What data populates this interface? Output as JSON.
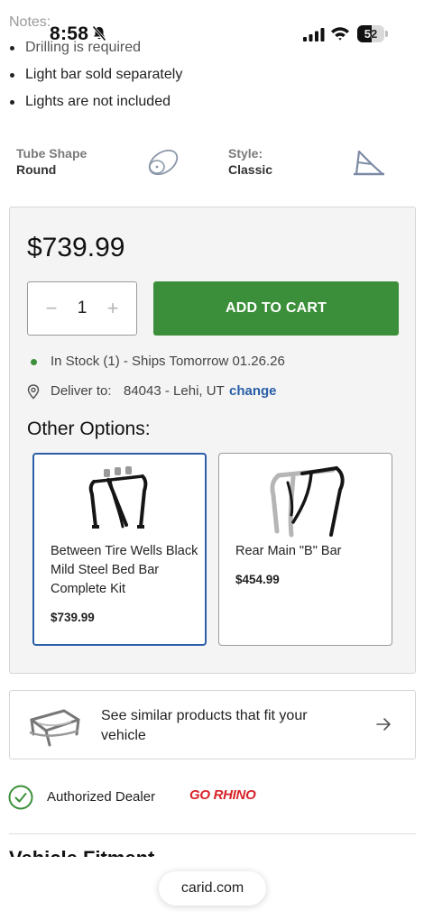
{
  "status_bar": {
    "notes_heading": "Notes:",
    "time": "8:58",
    "battery": "52",
    "battery_level": 0.52
  },
  "notes": [
    "Drilling is required",
    "Light bar sold separately",
    "Lights are not included"
  ],
  "specs": {
    "tube_shape_label": "Tube Shape",
    "tube_shape_value": "Round",
    "style_label": "Style:",
    "style_value": "Classic",
    "tube_icon": "round-tube-icon",
    "style_icon": "classic-style-icon"
  },
  "purchase": {
    "price": "$739.99",
    "qty_minus": "−",
    "qty_value": "1",
    "qty_plus": "+",
    "add_to_cart": "ADD TO CART",
    "stock_text": "In Stock (1) - Ships Tomorrow 01.26.26",
    "deliver_label": "Deliver to:",
    "deliver_zip": "84043 - Lehi, UT",
    "deliver_change": "change",
    "accent_green": "#3c8f3a",
    "link_blue": "#2a5ea8"
  },
  "other_options": {
    "title": "Other Options:",
    "items": [
      {
        "name": "Between Tire Wells Black Mild Steel Bed Bar Complete Kit",
        "price": "$739.99",
        "selected": true
      },
      {
        "name": "Rear Main \"B\" Bar",
        "price": "$454.99",
        "selected": false
      }
    ]
  },
  "similar": {
    "text": "See similar products that fit your vehicle",
    "arrow_icon": "arrow-right-icon"
  },
  "dealer": {
    "label": "Authorized Dealer",
    "brand": "GO RHINO",
    "brand_color": "#d8232a"
  },
  "section_heading": "Vehicle Fitment",
  "browser": {
    "url": "carid.com"
  }
}
